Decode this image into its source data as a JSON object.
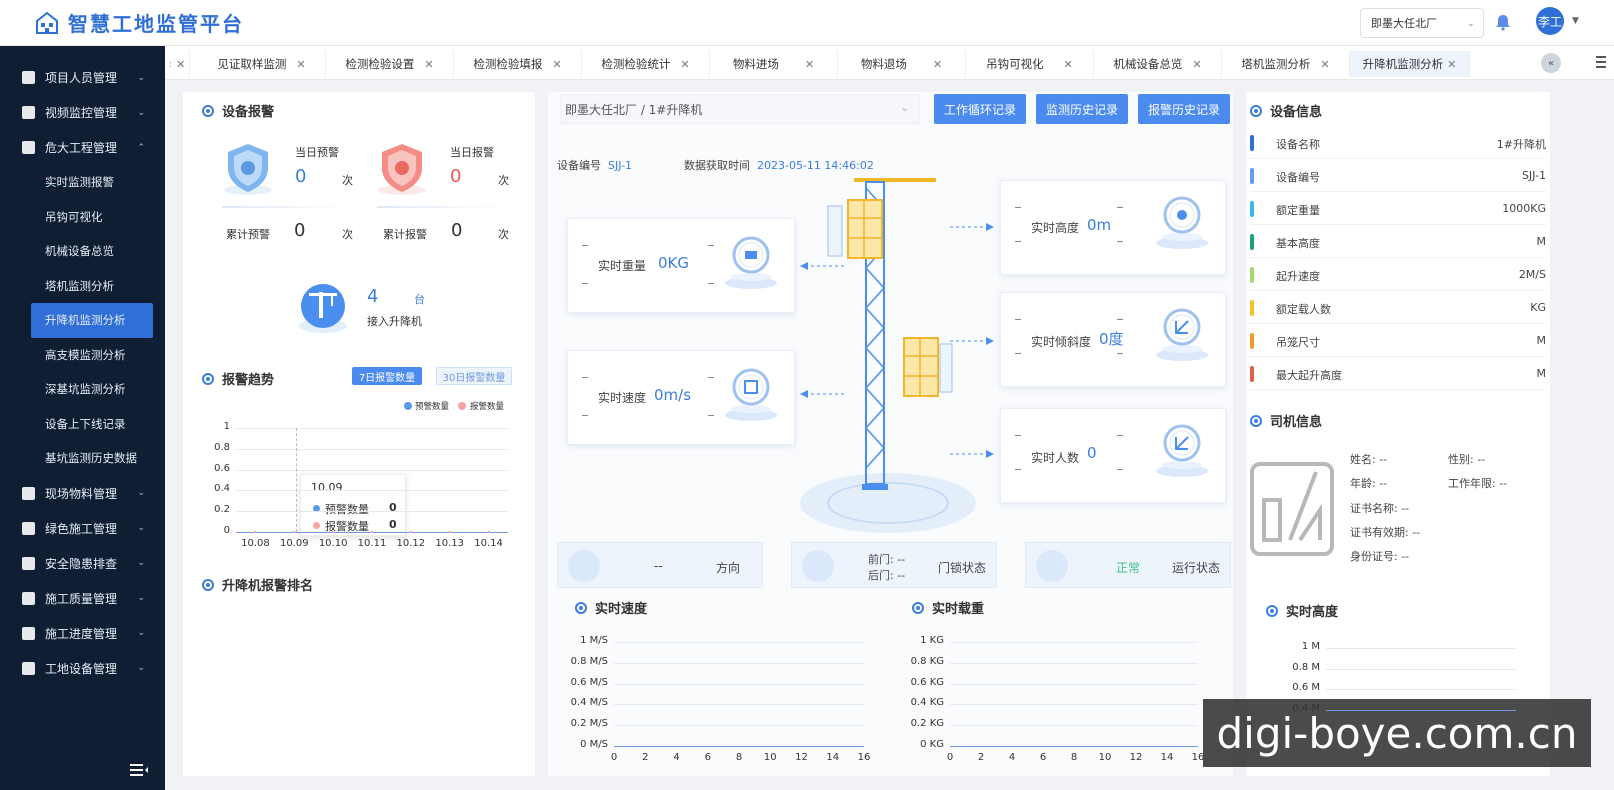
{
  "app": {
    "title": "智慧工地监管平台"
  },
  "header": {
    "site": "即墨大任北厂",
    "user": "李工"
  },
  "sidebar": {
    "items": [
      {
        "label": "项目人员管理"
      },
      {
        "label": "视频监控管理"
      },
      {
        "label": "危大工程管理"
      }
    ],
    "sub": [
      "实时监测报警",
      "吊钩可视化",
      "机械设备总览",
      "塔机监测分析",
      "升降机监测分析",
      "高支模监测分析",
      "深基坑监测分析",
      "设备上下线记录",
      "基坑监测历史数据"
    ],
    "after": [
      "现场物料管理",
      "绿色施工管理",
      "安全隐患排查",
      "施工质量管理",
      "施工进度管理",
      "工地设备管理"
    ]
  },
  "tabs": [
    "见证取样监测",
    "检测检验设置",
    "检测检验填报",
    "检测检验统计",
    "物料进场",
    "物料退场",
    "吊钩可视化",
    "机械设备总览",
    "塔机监测分析",
    "升降机监测分析"
  ],
  "alarm": {
    "title": "设备报警",
    "day_warn_label": "当日预警",
    "day_warn": "0",
    "day_alarm_label": "当日报警",
    "day_alarm": "0",
    "total_warn_label": "累计预警",
    "total_warn": "0",
    "total_alarm_label": "累计报警",
    "total_alarm": "0",
    "unit": "次",
    "elevator_count": "4",
    "elevator_unit": "台",
    "elevator_label": "接入升降机"
  },
  "trend": {
    "title": "报警趋势",
    "btn7": "7日报警数量",
    "btn30": "30日报警数量",
    "legend_warn": "预警数量",
    "legend_alarm": "报警数量",
    "tooltip_date": "10.09",
    "tooltip_warn": "0",
    "tooltip_alarm": "0"
  },
  "ranking": {
    "title": "升降机报警排名"
  },
  "device": {
    "path": "即墨大任北厂 / 1#升降机",
    "btn_cycle": "工作循环记录",
    "btn_monitor": "监测历史记录",
    "btn_alarm": "报警历史记录",
    "id_label": "设备编号",
    "id": "SJJ-1",
    "time_label": "数据获取时间",
    "time": "2023-05-11 14:46:02",
    "weight_label": "实时重量",
    "weight": "0KG",
    "speed_label": "实时速度",
    "speed": "0m/s",
    "height_label": "实时高度",
    "height": "0m",
    "tilt_label": "实时倾斜度",
    "tilt": "0度",
    "people_label": "实时人数",
    "people": "0",
    "direction_val": "--",
    "direction_label": "方向",
    "door_front": "前门: --",
    "door_back": "后门: --",
    "door_label": "门锁状态",
    "run_val": "正常",
    "run_label": "运行状态"
  },
  "info": {
    "title": "设备信息",
    "rows": [
      {
        "k": "设备名称",
        "v": "1#升降机",
        "c": "#2f6fd6"
      },
      {
        "k": "设备编号",
        "v": "SJJ-1",
        "c": "#6a9cf0"
      },
      {
        "k": "额定重量",
        "v": "1000KG",
        "c": "#38b8e8"
      },
      {
        "k": "基本高度",
        "v": "M",
        "c": "#1aa36f"
      },
      {
        "k": "起升速度",
        "v": "2M/S",
        "c": "#a6d870"
      },
      {
        "k": "额定载人数",
        "v": "KG",
        "c": "#f5c230"
      },
      {
        "k": "吊笼尺寸",
        "v": "M",
        "c": "#f29a2e"
      },
      {
        "k": "最大起升高度",
        "v": "M",
        "c": "#e25f4a"
      }
    ]
  },
  "driver": {
    "title": "司机信息",
    "name": "姓名: --",
    "gender": "性别: --",
    "age": "年龄: --",
    "years": "工作年限: --",
    "cert": "证书名称: --",
    "valid": "证书有效期: --",
    "idno": "身份证号: --"
  },
  "chart_data": [
    {
      "type": "line",
      "title": "",
      "x": [
        "10.08",
        "10.09",
        "10.10",
        "10.11",
        "10.12",
        "10.13",
        "10.14"
      ],
      "series": [
        {
          "name": "预警数量",
          "values": [
            0,
            0,
            0,
            0,
            0,
            0,
            0
          ]
        },
        {
          "name": "报警数量",
          "values": [
            0,
            0,
            0,
            0,
            0,
            0,
            0
          ]
        }
      ],
      "yticks": [
        "0",
        "0.2",
        "0.4",
        "0.6",
        "0.8",
        "1"
      ],
      "ylim": [
        0,
        1
      ]
    },
    {
      "type": "line",
      "title": "实时速度",
      "x": [
        "0",
        "2",
        "4",
        "6",
        "8",
        "10",
        "12",
        "14",
        "16"
      ],
      "yticks": [
        "0 M/S",
        "0.2 M/S",
        "0.4 M/S",
        "0.6 M/S",
        "0.8 M/S",
        "1 M/S"
      ],
      "ylim": [
        0,
        1
      ]
    },
    {
      "type": "line",
      "title": "实时载重",
      "x": [
        "0",
        "2",
        "4",
        "6",
        "8",
        "10",
        "12",
        "14",
        "16"
      ],
      "yticks": [
        "0 KG",
        "0.2 KG",
        "0.4 KG",
        "0.6 KG",
        "0.8 KG",
        "1 KG"
      ],
      "ylim": [
        0,
        1
      ]
    },
    {
      "type": "line",
      "title": "实时高度",
      "yticks": [
        "0.4 M",
        "0.6 M",
        "0.8 M",
        "1 M"
      ],
      "ylim": [
        0,
        1
      ]
    }
  ],
  "watermark": "digi-boye.com.cn"
}
